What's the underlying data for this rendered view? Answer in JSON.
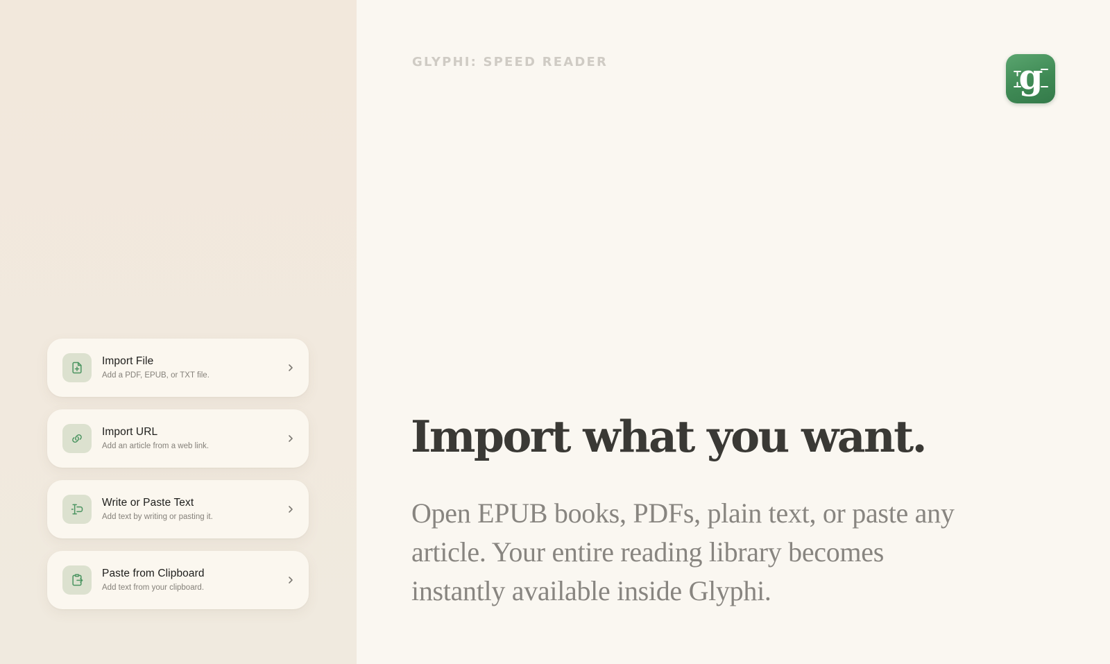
{
  "brand": {
    "label": "GLYPHI: SPEED READER"
  },
  "app_icon": {
    "glyph": "g"
  },
  "hero": {
    "headline": "Import what you want.",
    "body": "Open EPUB books, PDFs, plain text, or paste any article. Your entire reading library becomes instantly available inside Glyphi."
  },
  "import_options": [
    {
      "title": "Import File",
      "subtitle": "Add a PDF, EPUB, or TXT file.",
      "icon": "file-plus-icon"
    },
    {
      "title": "Import URL",
      "subtitle": "Add an article from a web link.",
      "icon": "link-icon"
    },
    {
      "title": "Write or Paste Text",
      "subtitle": "Add text by writing or pasting it.",
      "icon": "text-cursor-icon"
    },
    {
      "title": "Paste from Clipboard",
      "subtitle": "Add text from your clipboard.",
      "icon": "clipboard-icon"
    }
  ],
  "colors": {
    "accent": "#4a9460",
    "icon_bg": "#dce1cf",
    "left_panel": "#f1e9de",
    "right_panel": "#faf7f1"
  }
}
